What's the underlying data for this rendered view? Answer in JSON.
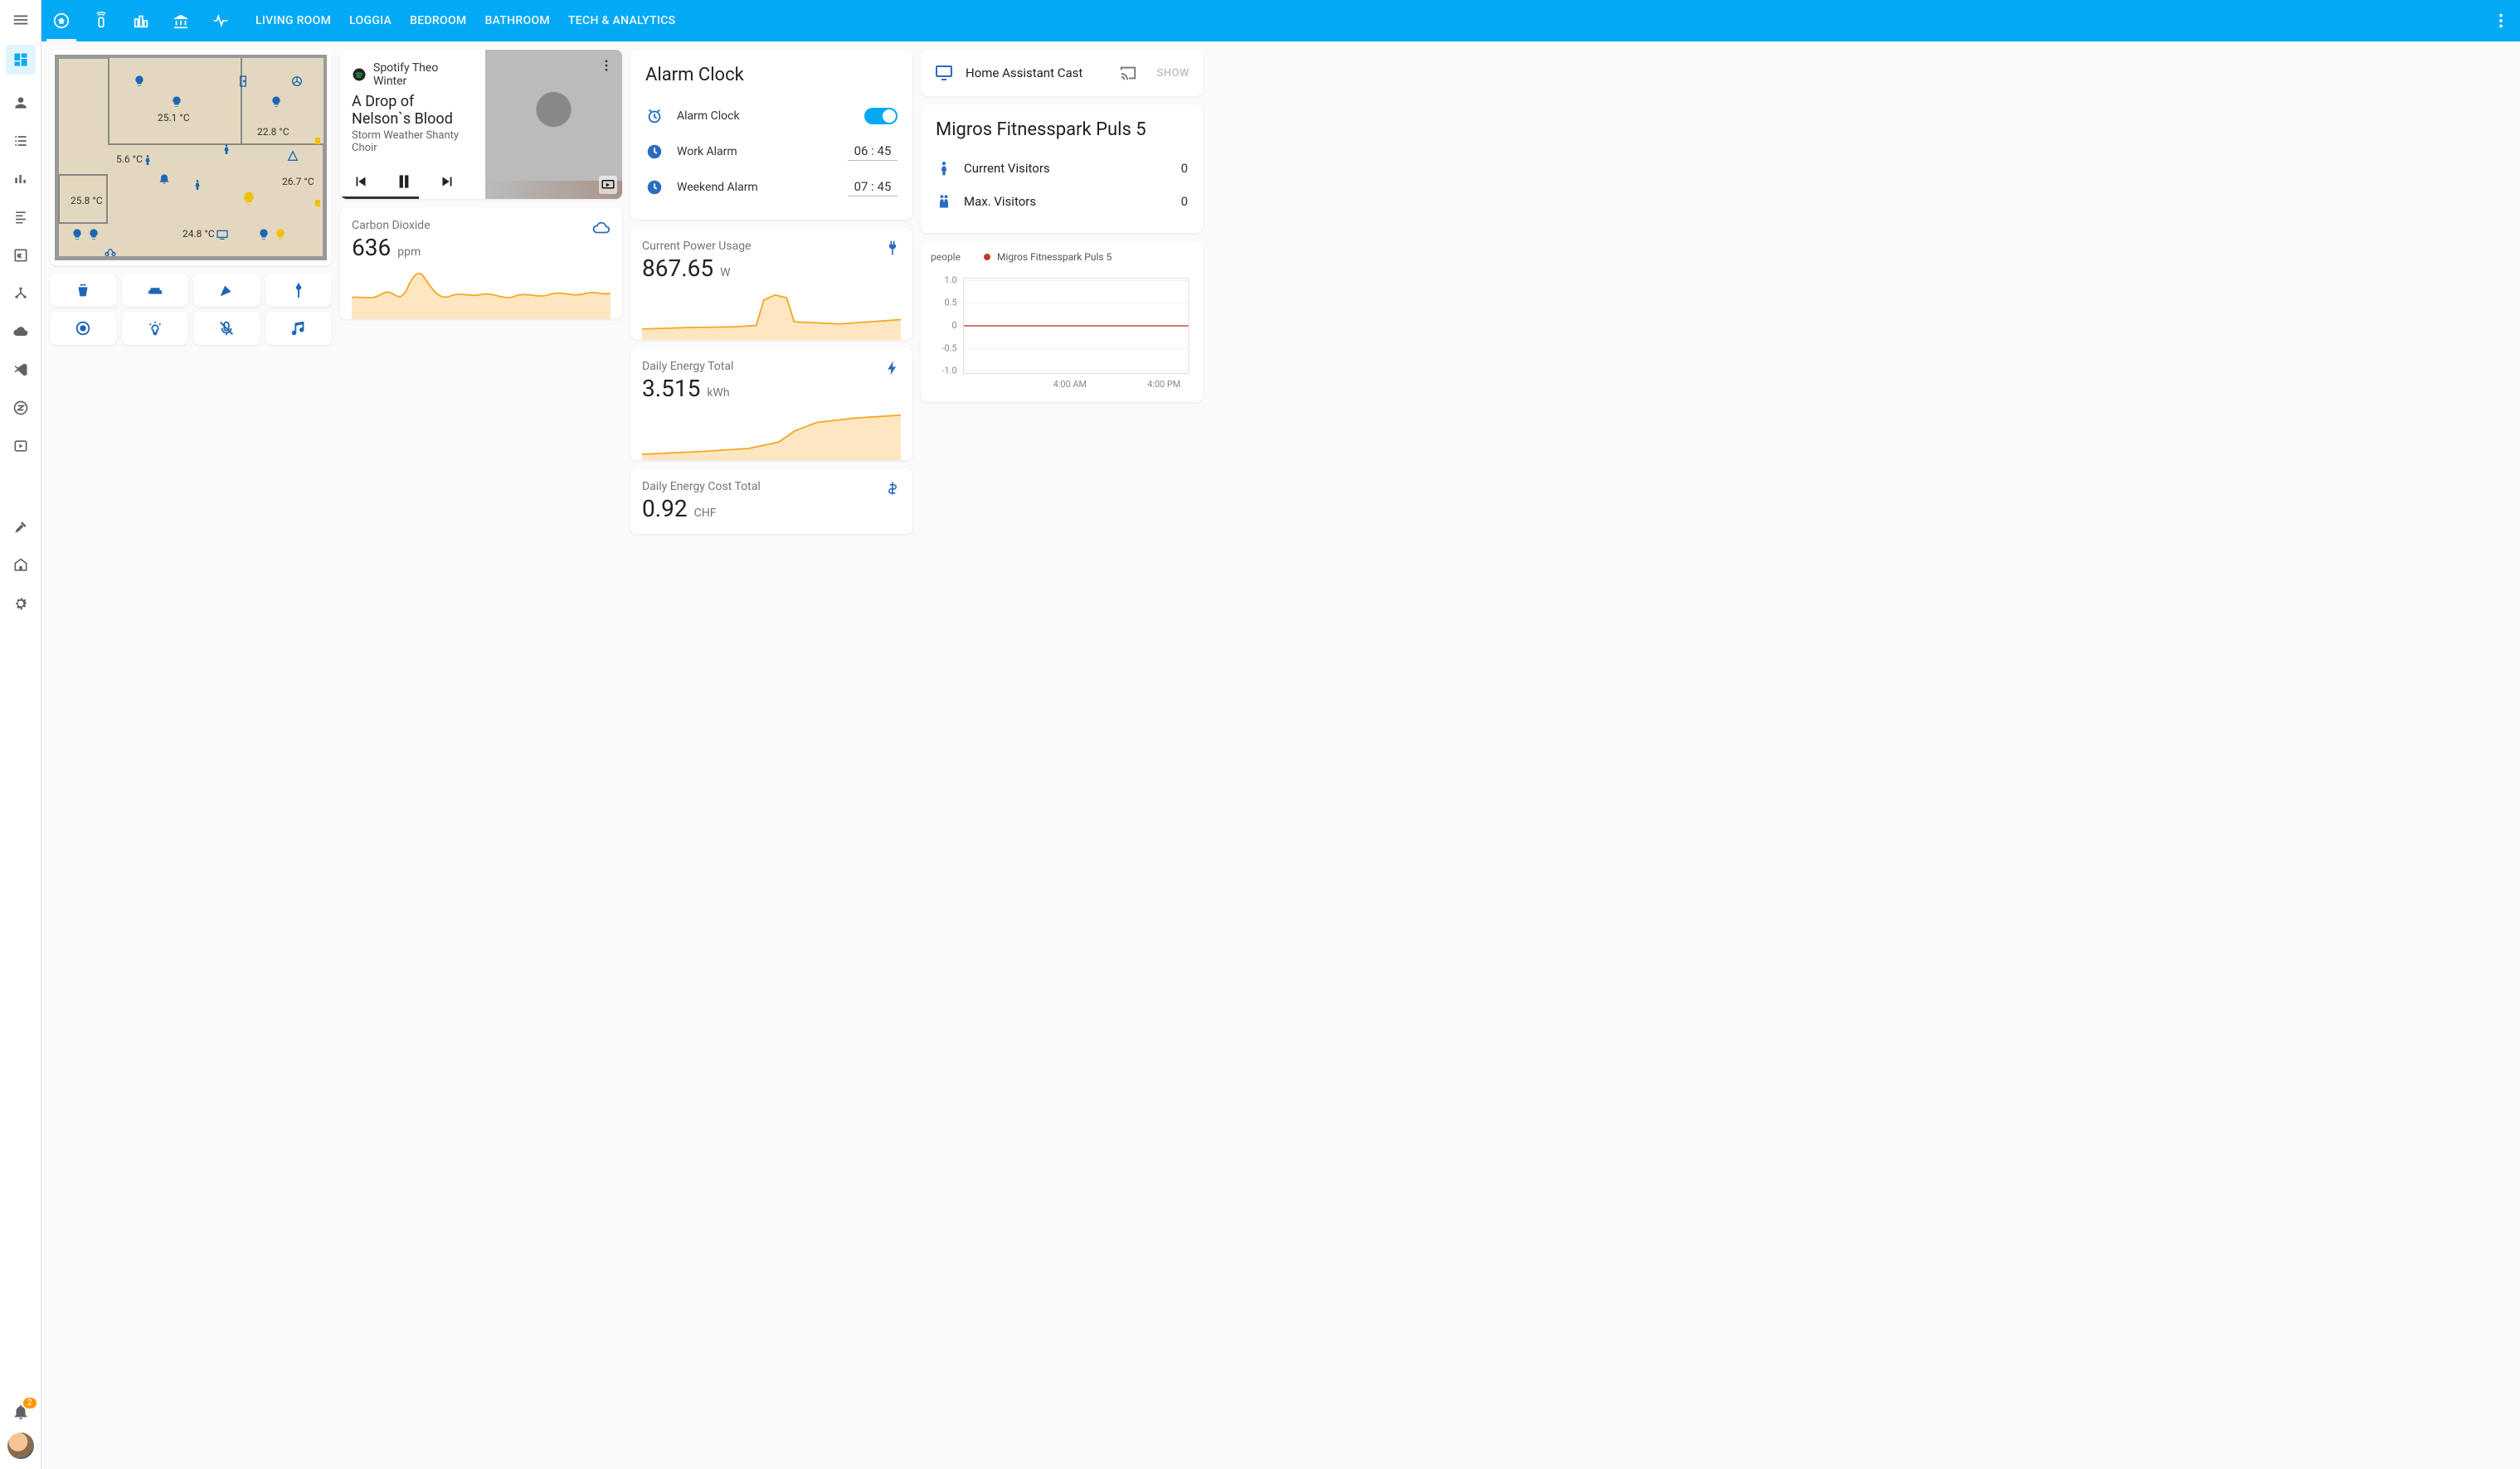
{
  "sidebar": {
    "notifications_count": "2"
  },
  "header": {
    "tabs": [
      {
        "label": "LIVING ROOM"
      },
      {
        "label": "LOGGIA"
      },
      {
        "label": "BEDROOM"
      },
      {
        "label": "BATHROOM"
      },
      {
        "label": "TECH & ANALYTICS"
      }
    ]
  },
  "floorplan": {
    "temps": {
      "living": "25.1 °C",
      "bedroom": "22.8 °C",
      "hall": "5.6 °C",
      "bath": "25.8 °C",
      "lower": "24.8 °C",
      "loggia": "26.7 °C"
    }
  },
  "media": {
    "source": "Spotify Theo Winter",
    "title": "A Drop of Nelson`s Blood",
    "artist": "Storm Weather Shanty Choir"
  },
  "co2": {
    "name": "Carbon Dioxide",
    "value": "636",
    "unit": "ppm"
  },
  "alarm": {
    "title": "Alarm Clock",
    "rows": {
      "clock_label": "Alarm Clock",
      "work_label": "Work Alarm",
      "work_time": "06 : 45",
      "weekend_label": "Weekend Alarm",
      "weekend_time": "07 : 45"
    }
  },
  "power": {
    "name": "Current Power Usage",
    "value": "867.65",
    "unit": "W"
  },
  "energy_total": {
    "name": "Daily Energy Total",
    "value": "3.515",
    "unit": "kWh"
  },
  "energy_cost": {
    "name": "Daily Energy Cost Total",
    "value": "0.92",
    "unit": "CHF"
  },
  "cast": {
    "label": "Home Assistant Cast",
    "button": "SHOW"
  },
  "gym": {
    "title": "Migros Fitnesspark Puls 5",
    "rows": [
      {
        "label": "Current Visitors",
        "value": "0"
      },
      {
        "label": "Max. Visitors",
        "value": "0"
      }
    ]
  },
  "chart": {
    "y_title": "people",
    "legend": "Migros Fitnesspark Puls 5",
    "x_ticks": [
      "4:00 AM",
      "4:00 PM"
    ],
    "y_ticks": [
      "1.0",
      "0.5",
      "0",
      "-0.5",
      "-1.0"
    ]
  },
  "chart_data": {
    "type": "line",
    "title": "",
    "xlabel": "",
    "ylabel": "people",
    "ylim": [
      -1.0,
      1.0
    ],
    "x": [
      "4:00 AM",
      "4:00 PM"
    ],
    "series": [
      {
        "name": "Migros Fitnesspark Puls 5",
        "values": [
          0,
          0
        ]
      }
    ]
  }
}
